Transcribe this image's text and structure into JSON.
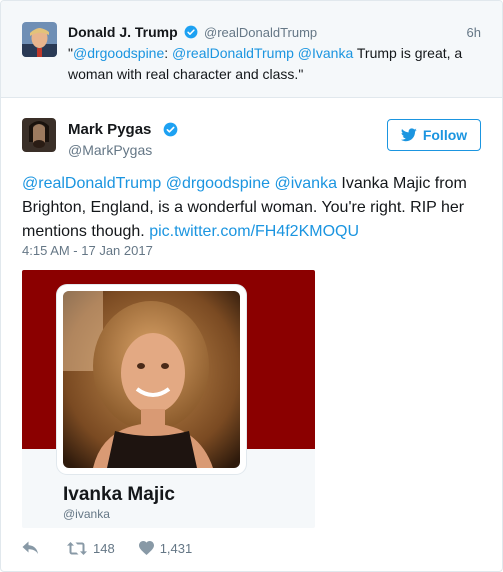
{
  "quoted": {
    "name": "Donald J. Trump",
    "handle": "@realDonaldTrump",
    "time": "6h",
    "text_open": "\"",
    "mention1": "@drgoodspine",
    "sep1": ": ",
    "mention2": "@realDonaldTrump",
    "sep2": " ",
    "mention3": "@Ivanka",
    "text_rest": " Trump is great, a woman with real character and class.\""
  },
  "tweet": {
    "name": "Mark Pygas",
    "handle": "@MarkPygas",
    "follow_label": "Follow",
    "mention1": "@realDonaldTrump",
    "mention2": "@drgoodspine",
    "mention3": "@ivanka",
    "body": " Ivanka Majic from Brighton, England, is a wonderful woman. You're right. RIP her mentions though. ",
    "pic_link": "pic.twitter.com/FH4f2KMOQU",
    "timestamp": "4:15 AM - 17 Jan 2017"
  },
  "card": {
    "name": "Ivanka Majic",
    "handle": "@ivanka"
  },
  "actions": {
    "retweets": "148",
    "likes": "1,431"
  },
  "colors": {
    "link": "#1b95e0",
    "muted": "#657786",
    "banner": "#8b0000",
    "verified": "#1da1f2"
  },
  "icons": {
    "verified": "verified-badge-icon",
    "follow": "twitter-bird-icon",
    "reply": "reply-icon",
    "retweet": "retweet-icon",
    "like": "heart-icon"
  }
}
